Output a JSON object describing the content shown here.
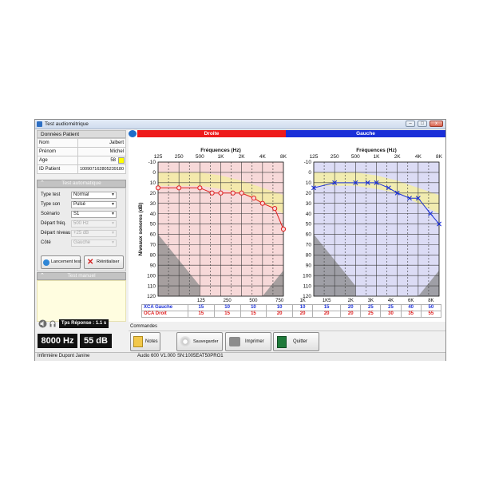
{
  "window": {
    "title": "Test audiométrique",
    "buttons": [
      "–",
      "□",
      "x"
    ]
  },
  "patient": {
    "header": "Données Patient",
    "fields": [
      {
        "label": "Nom",
        "value": "Jalbert"
      },
      {
        "label": "Prénom",
        "value": "Michel"
      },
      {
        "label": "Age",
        "value": "58"
      },
      {
        "label": "ID Patient",
        "value": "100907162805239180"
      }
    ],
    "age_color": "#ffff00"
  },
  "auto_test": {
    "header": "Test automatique",
    "fields": [
      {
        "label": "Type test",
        "value": "Normal",
        "enabled": true
      },
      {
        "label": "Type son",
        "value": "Pulsé",
        "enabled": true
      },
      {
        "label": "Scénario",
        "value": "S1",
        "enabled": true
      },
      {
        "label": "Départ fréq.",
        "value": "500 Hz",
        "enabled": false
      },
      {
        "label": "Départ niveau",
        "value": "+25 dB",
        "enabled": false
      },
      {
        "label": "Côté",
        "value": "Gauche",
        "enabled": false
      }
    ],
    "start_button": "Lancement test",
    "reset_button": "Réinitialiser"
  },
  "manual_test": {
    "header": "Test manuel"
  },
  "response_time": "Tps Réponse : 1.1 s",
  "readouts": {
    "frequency": "8000 Hz",
    "level": "55 dB"
  },
  "charts": {
    "right": {
      "banner": "Droite",
      "banner_color": "#ee1a1a"
    },
    "left": {
      "banner": "Gauche",
      "banner_color": "#1a2fd8"
    },
    "axis_title": "Fréquences (Hz)",
    "y_axis_title": "Niveaux sonores (dB)"
  },
  "chart_data": [
    {
      "type": "line",
      "ear": "Droite",
      "xlabel": "Fréquences (Hz)",
      "ylabel": "Niveaux sonores (dB)",
      "x_ticks_top": [
        "125",
        "250",
        "500",
        "1K",
        "2K",
        "4K",
        "8K"
      ],
      "x_ticks_bottom": [
        "125",
        "250",
        "500",
        "750",
        "1K"
      ],
      "y_ticks": [
        "-10",
        "0",
        "10",
        "20",
        "30",
        "40",
        "50",
        "60",
        "70",
        "80",
        "90",
        "100",
        "110",
        "120"
      ],
      "ylim": [
        -10,
        120
      ],
      "y_inverted": true,
      "color": "#e02020",
      "series": [
        {
          "name": "CA Droit",
          "x": [
            125,
            250,
            500,
            750,
            1000,
            1500,
            2000,
            3000,
            4000,
            6000,
            8000
          ],
          "values": [
            15,
            15,
            15,
            20,
            20,
            20,
            20,
            25,
            30,
            35,
            55
          ]
        }
      ]
    },
    {
      "type": "line",
      "ear": "Gauche",
      "xlabel": "Fréquences (Hz)",
      "ylabel": "",
      "x_ticks_top": [
        "125",
        "250",
        "500",
        "1K",
        "2K",
        "4K",
        "8K"
      ],
      "x_ticks_bottom": [
        "1K5",
        "2K",
        "3K",
        "4K",
        "6K",
        "8K"
      ],
      "y_ticks": [
        "-10",
        "0",
        "10",
        "20",
        "30",
        "40",
        "50",
        "60",
        "70",
        "80",
        "90",
        "100",
        "110",
        "120"
      ],
      "ylim": [
        -10,
        120
      ],
      "y_inverted": true,
      "color": "#1a2fd8",
      "series": [
        {
          "name": "CA Gauche",
          "x": [
            125,
            250,
            500,
            750,
            1000,
            1500,
            2000,
            3000,
            4000,
            6000,
            8000
          ],
          "values": [
            15,
            10,
            10,
            10,
            10,
            15,
            20,
            25,
            25,
            40,
            50
          ]
        }
      ]
    }
  ],
  "threshold_table": {
    "rows": [
      {
        "label": "CA Gauche",
        "marker": "X",
        "color": "#1a2fd8",
        "values": [
          "15",
          "10",
          "10",
          "10",
          "10",
          "15",
          "20",
          "25",
          "25",
          "40",
          "50"
        ]
      },
      {
        "label": "CA Droit",
        "marker": "O",
        "color": "#e02020",
        "values": [
          "15",
          "15",
          "15",
          "20",
          "20",
          "20",
          "20",
          "25",
          "30",
          "35",
          "55"
        ]
      }
    ],
    "headers": [
      "125",
      "250",
      "500",
      "750",
      "1K",
      "1K5",
      "2K",
      "3K",
      "4K",
      "6K",
      "8K"
    ]
  },
  "commands": {
    "label": "Commandes",
    "buttons": [
      {
        "id": "notes",
        "label": "Notes"
      },
      {
        "id": "save",
        "label": "Sauvegarder"
      },
      {
        "id": "print",
        "label": "Imprimer"
      },
      {
        "id": "quit",
        "label": "Quitter"
      }
    ]
  },
  "status": {
    "user": "Infirmière Dupont Janine",
    "device": "Audio 600 V1.000",
    "serial": "SN:1005EAT50PRO1"
  }
}
